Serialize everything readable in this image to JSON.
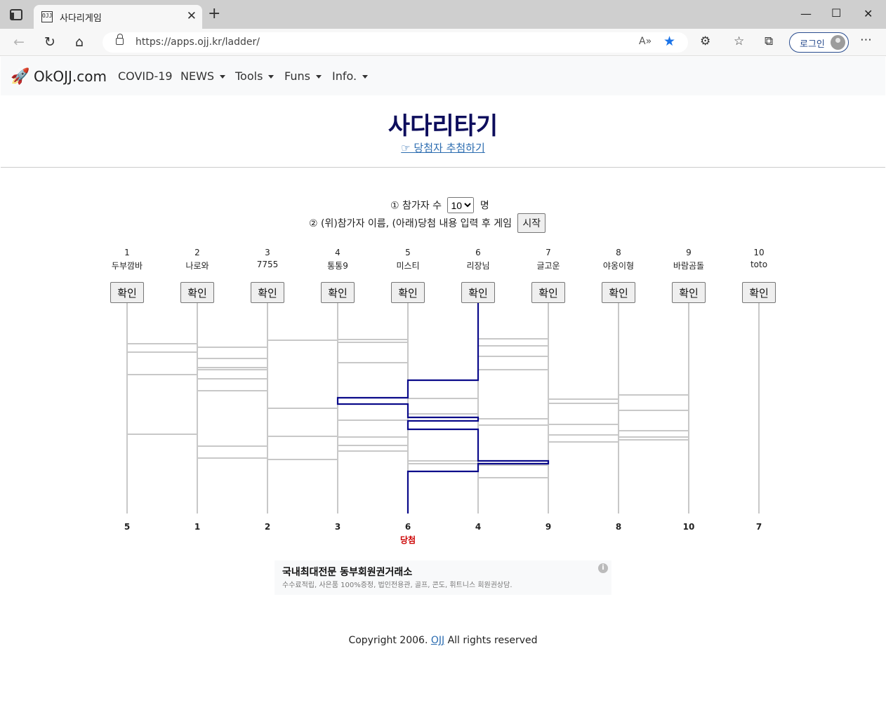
{
  "browser": {
    "tab_title": "사다리게임",
    "favicon_text": "OJJ",
    "url": "https://apps.ojj.kr/ladder/",
    "login_label": "로그인"
  },
  "navbar": {
    "brand": "OkOJJ.com",
    "items": [
      {
        "label": "COVID-19",
        "dropdown": false
      },
      {
        "label": "NEWS",
        "dropdown": true
      },
      {
        "label": "Tools",
        "dropdown": true
      },
      {
        "label": "Funs",
        "dropdown": true
      },
      {
        "label": "Info.",
        "dropdown": true
      }
    ]
  },
  "header": {
    "title": "사다리타기",
    "link": "☞ 당첨자 추첨하기"
  },
  "controls": {
    "step1_prefix": "① 참가자 수",
    "count_selected": "10",
    "step1_suffix": "명",
    "step2_text": "② (위)참가자 이름, (아래)당첨 내용 입력 후 게임",
    "start_label": "시작"
  },
  "participants": [
    {
      "num": "1",
      "name": "두부깜바"
    },
    {
      "num": "2",
      "name": "나로와"
    },
    {
      "num": "3",
      "name": "7755"
    },
    {
      "num": "4",
      "name": "통통9"
    },
    {
      "num": "5",
      "name": "미스티"
    },
    {
      "num": "6",
      "name": "리장님"
    },
    {
      "num": "7",
      "name": "글고운"
    },
    {
      "num": "8",
      "name": "야옹이형"
    },
    {
      "num": "9",
      "name": "바람곰돌"
    },
    {
      "num": "10",
      "name": "toto"
    }
  ],
  "confirm_label": "확인",
  "results": [
    "5",
    "1",
    "2",
    "3",
    "6",
    "4",
    "9",
    "8",
    "10",
    "7"
  ],
  "winner": {
    "column": 5,
    "label": "당첨"
  },
  "colors": {
    "highlight_path": "#0a0a8a",
    "ladder_line": "#c8c8c8",
    "winner_text": "#cc0000",
    "title": "#0d0d5c"
  },
  "ad": {
    "title": "국내최대전문 동부회원권거래소",
    "description": "수수료적립, 사은품 100%증정, 법인전용관, 골프, 콘도, 휘트니스 회원권상담.",
    "info_icon": "i"
  },
  "footer": {
    "prefix": "Copyright 2006. ",
    "link": "OJJ",
    "suffix": " All rights reserved"
  }
}
